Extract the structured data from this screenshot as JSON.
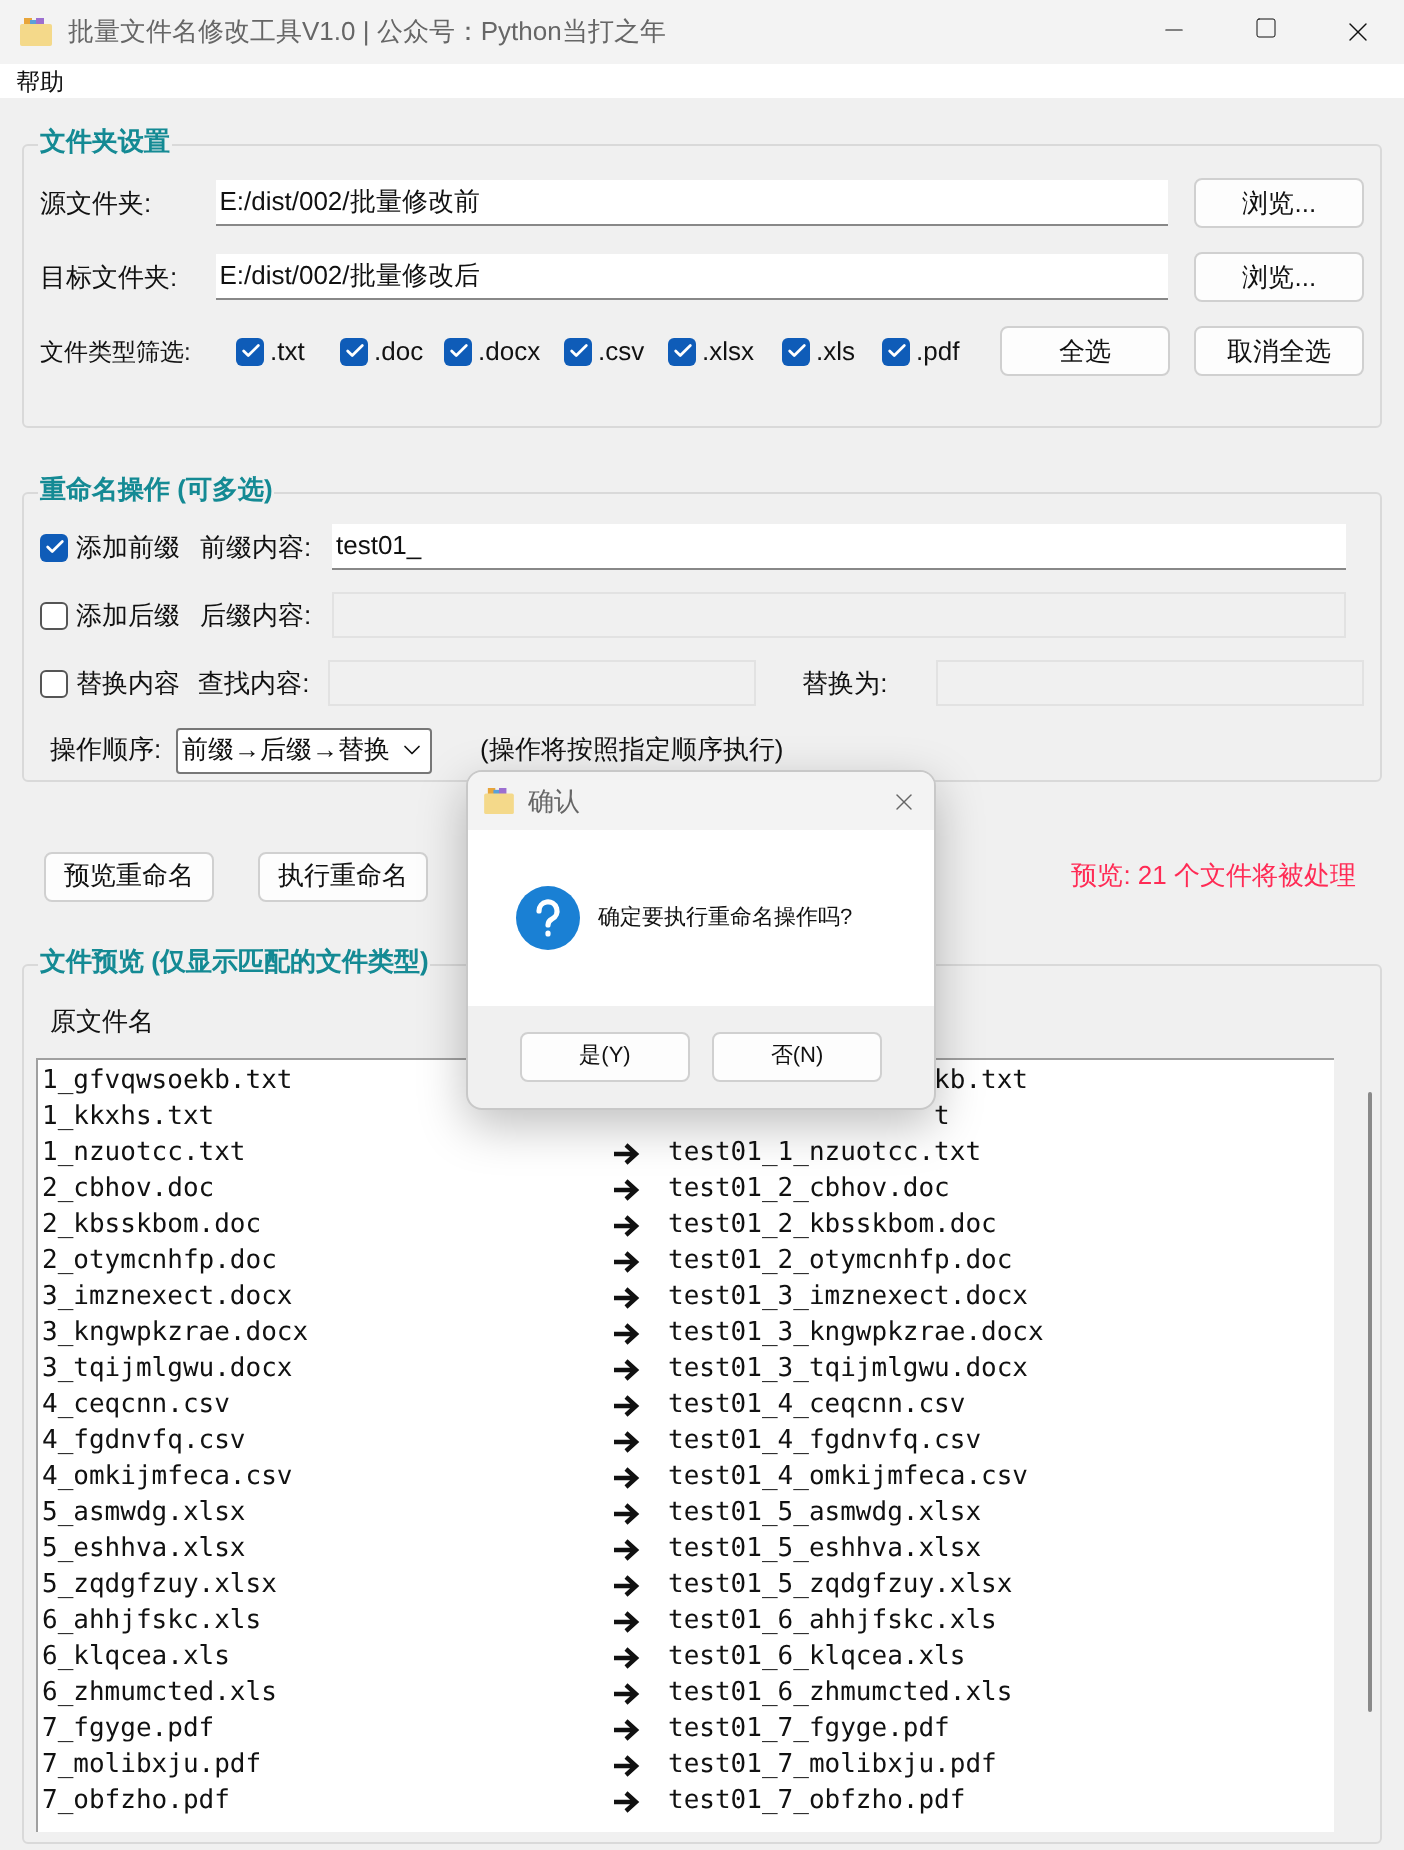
{
  "window": {
    "title": "批量文件名修改工具V1.0 | 公众号：Python当打之年"
  },
  "menu": [
    "帮助"
  ],
  "folder_group": {
    "title": "文件夹设置",
    "rows": [
      {
        "label": "源文件夹:",
        "value": "E:/dist/002/批量修改前",
        "button": "浏览..."
      },
      {
        "label": "目标文件夹:",
        "value": "E:/dist/002/批量修改后",
        "button": "浏览..."
      }
    ],
    "filter_label": "文件类型筛选:",
    "filters": [
      {
        "label": ".txt",
        "checked": true
      },
      {
        "label": ".doc",
        "checked": true
      },
      {
        "label": ".docx",
        "checked": true
      },
      {
        "label": ".csv",
        "checked": true
      },
      {
        "label": ".xlsx",
        "checked": true
      },
      {
        "label": ".xls",
        "checked": true
      },
      {
        "label": ".pdf",
        "checked": true
      }
    ],
    "select_all": "全选",
    "deselect_all": "取消全选"
  },
  "rename_group": {
    "title": "重命名操作 (可多选)",
    "prefix": {
      "label": "添加前缀",
      "checked": true,
      "field_label": "前缀内容:",
      "value": "test01_"
    },
    "suffix": {
      "label": "添加后缀",
      "checked": false,
      "field_label": "后缀内容:"
    },
    "replace": {
      "label": "替换内容",
      "checked": false,
      "field_label": "查找内容:",
      "replace_label": "替换为:"
    },
    "order_label": "操作顺序:",
    "order_value": "前缀→后缀→替换",
    "order_note": "(操作将按照指定顺序执行)"
  },
  "actions": {
    "preview": "预览重命名",
    "execute": "执行重命名",
    "status": "预览: 21 个文件将被处理"
  },
  "preview_group": {
    "title": "文件预览 (仅显示匹配的文件类型)",
    "column_1": "原文件名",
    "rows": [
      {
        "kind": "partial",
        "old": "1_gfvqwsoekb.txt",
        "new": "kb.txt"
      },
      {
        "kind": "partial",
        "old": "1_kkxhs.txt",
        "new": "t"
      },
      {
        "kind": "full",
        "old": "1_nzuotcc.txt",
        "new": "test01_1_nzuotcc.txt"
      },
      {
        "kind": "full",
        "old": "2_cbhov.doc",
        "new": "test01_2_cbhov.doc"
      },
      {
        "kind": "full",
        "old": "2_kbsskbom.doc",
        "new": "test01_2_kbsskbom.doc"
      },
      {
        "kind": "full",
        "old": "2_otymcnhfp.doc",
        "new": "test01_2_otymcnhfp.doc"
      },
      {
        "kind": "full",
        "old": "3_imznexect.docx",
        "new": "test01_3_imznexect.docx"
      },
      {
        "kind": "full",
        "old": "3_kngwpkzrae.docx",
        "new": "test01_3_kngwpkzrae.docx"
      },
      {
        "kind": "full",
        "old": "3_tqijmlgwu.docx",
        "new": "test01_3_tqijmlgwu.docx"
      },
      {
        "kind": "full",
        "old": "4_ceqcnn.csv",
        "new": "test01_4_ceqcnn.csv"
      },
      {
        "kind": "full",
        "old": "4_fgdnvfq.csv",
        "new": "test01_4_fgdnvfq.csv"
      },
      {
        "kind": "full",
        "old": "4_omkijmfeca.csv",
        "new": "test01_4_omkijmfeca.csv"
      },
      {
        "kind": "full",
        "old": "5_asmwdg.xlsx",
        "new": "test01_5_asmwdg.xlsx"
      },
      {
        "kind": "full",
        "old": "5_eshhva.xlsx",
        "new": "test01_5_eshhva.xlsx"
      },
      {
        "kind": "full",
        "old": "5_zqdgfzuy.xlsx",
        "new": "test01_5_zqdgfzuy.xlsx"
      },
      {
        "kind": "full",
        "old": "6_ahhjfskc.xls",
        "new": "test01_6_ahhjfskc.xls"
      },
      {
        "kind": "full",
        "old": "6_klqcea.xls",
        "new": "test01_6_klqcea.xls"
      },
      {
        "kind": "full",
        "old": "6_zhmumcted.xls",
        "new": "test01_6_zhmumcted.xls"
      },
      {
        "kind": "full",
        "old": "7_fgyge.pdf",
        "new": "test01_7_fgyge.pdf"
      },
      {
        "kind": "full",
        "old": "7_molibxju.pdf",
        "new": "test01_7_molibxju.pdf"
      },
      {
        "kind": "full",
        "old": "7_obfzho.pdf",
        "new": "test01_7_obfzho.pdf"
      }
    ]
  },
  "dialog": {
    "title": "确认",
    "message": "确定要执行重命名操作吗?",
    "buttons": [
      "是(Y)",
      "否(N)"
    ]
  }
}
